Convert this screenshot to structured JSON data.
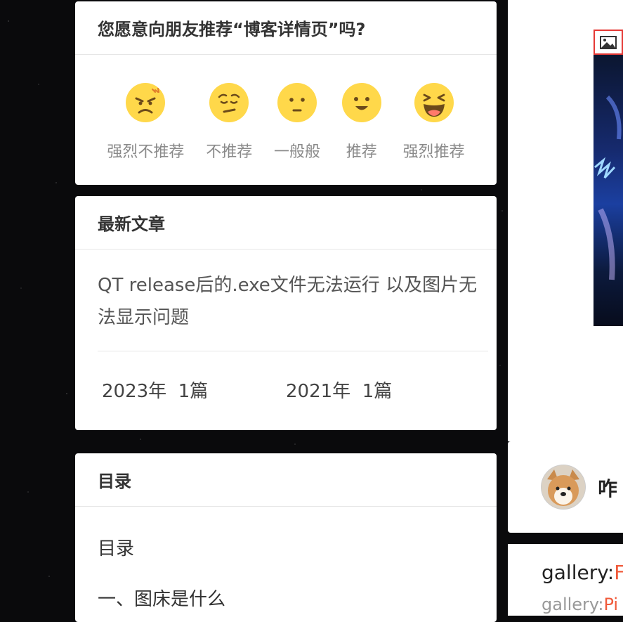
{
  "recommend": {
    "title": "您愿意向朋友推荐“博客详情页”吗?",
    "options": [
      {
        "label": "强烈不推荐",
        "icon": "angry-face-icon"
      },
      {
        "label": "不推荐",
        "icon": "worried-face-icon"
      },
      {
        "label": "一般般",
        "icon": "neutral-face-icon"
      },
      {
        "label": "推荐",
        "icon": "smile-face-icon"
      },
      {
        "label": "强烈推荐",
        "icon": "grinning-squint-face-icon"
      }
    ],
    "emoji_color": "#FFD84A"
  },
  "latest": {
    "title": "最新文章",
    "article": "QT release后的.exe文件无法运行 以及图片无法显示问题",
    "archives": [
      {
        "year": "2023年",
        "count": "1篇"
      },
      {
        "year": "2021年",
        "count": "1篇"
      }
    ]
  },
  "toc": {
    "title": "目录",
    "items": [
      "目录",
      "一、图床是什么"
    ]
  },
  "right": {
    "image_icon": "image-icon",
    "author_name": "咋",
    "gallery_line1_prefix": "gallery:",
    "gallery_line1_highlight": "F",
    "gallery_line2_prefix": "gallery:",
    "gallery_line2_highlight": "Pi"
  },
  "colors": {
    "background": "#0a0a0c",
    "card": "#ffffff",
    "highlight": "#f05a3a",
    "image_border": "#e53935"
  }
}
